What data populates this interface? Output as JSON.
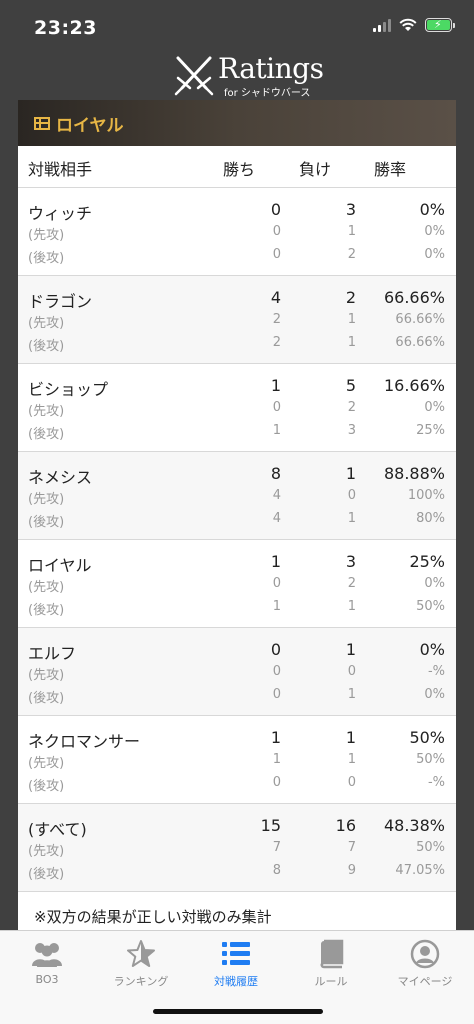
{
  "status": {
    "time": "23:23"
  },
  "header": {
    "title": "Ratings",
    "subtitle": "for シャドウバース"
  },
  "class_header": {
    "name": "ロイヤル"
  },
  "table": {
    "columns": {
      "opponent": "対戦相手",
      "wins": "勝ち",
      "losses": "負け",
      "rate": "勝率"
    },
    "groups": [
      {
        "name": "ウィッチ",
        "wins": "0",
        "losses": "3",
        "rate": "0%",
        "first": {
          "label": "(先攻)",
          "wins": "0",
          "losses": "1",
          "rate": "0%"
        },
        "second": {
          "label": "(後攻)",
          "wins": "0",
          "losses": "2",
          "rate": "0%"
        }
      },
      {
        "name": "ドラゴン",
        "wins": "4",
        "losses": "2",
        "rate": "66.66%",
        "first": {
          "label": "(先攻)",
          "wins": "2",
          "losses": "1",
          "rate": "66.66%"
        },
        "second": {
          "label": "(後攻)",
          "wins": "2",
          "losses": "1",
          "rate": "66.66%"
        }
      },
      {
        "name": "ビショップ",
        "wins": "1",
        "losses": "5",
        "rate": "16.66%",
        "first": {
          "label": "(先攻)",
          "wins": "0",
          "losses": "2",
          "rate": "0%"
        },
        "second": {
          "label": "(後攻)",
          "wins": "1",
          "losses": "3",
          "rate": "25%"
        }
      },
      {
        "name": "ネメシス",
        "wins": "8",
        "losses": "1",
        "rate": "88.88%",
        "first": {
          "label": "(先攻)",
          "wins": "4",
          "losses": "0",
          "rate": "100%"
        },
        "second": {
          "label": "(後攻)",
          "wins": "4",
          "losses": "1",
          "rate": "80%"
        }
      },
      {
        "name": "ロイヤル",
        "wins": "1",
        "losses": "3",
        "rate": "25%",
        "first": {
          "label": "(先攻)",
          "wins": "0",
          "losses": "2",
          "rate": "0%"
        },
        "second": {
          "label": "(後攻)",
          "wins": "1",
          "losses": "1",
          "rate": "50%"
        }
      },
      {
        "name": "エルフ",
        "wins": "0",
        "losses": "1",
        "rate": "0%",
        "first": {
          "label": "(先攻)",
          "wins": "0",
          "losses": "0",
          "rate": "-%"
        },
        "second": {
          "label": "(後攻)",
          "wins": "0",
          "losses": "1",
          "rate": "0%"
        }
      },
      {
        "name": "ネクロマンサー",
        "wins": "1",
        "losses": "1",
        "rate": "50%",
        "first": {
          "label": "(先攻)",
          "wins": "1",
          "losses": "1",
          "rate": "50%"
        },
        "second": {
          "label": "(後攻)",
          "wins": "0",
          "losses": "0",
          "rate": "-%"
        }
      },
      {
        "name": "(すべて)",
        "wins": "15",
        "losses": "16",
        "rate": "48.38%",
        "first": {
          "label": "(先攻)",
          "wins": "7",
          "losses": "7",
          "rate": "50%"
        },
        "second": {
          "label": "(後攻)",
          "wins": "8",
          "losses": "9",
          "rate": "47.05%"
        }
      }
    ]
  },
  "footnote": "※双方の結果が正しい対戦のみ集計",
  "tabs": [
    {
      "label": "BO3",
      "icon": "people-icon"
    },
    {
      "label": "ランキング",
      "icon": "star-icon"
    },
    {
      "label": "対戦履歴",
      "icon": "list-icon",
      "active": true
    },
    {
      "label": "ルール",
      "icon": "book-icon"
    },
    {
      "label": "マイページ",
      "icon": "person-icon"
    }
  ],
  "colors": {
    "accent": "#1e7cf2",
    "class_gold": "#e7b645",
    "header_bg": "#404040"
  }
}
